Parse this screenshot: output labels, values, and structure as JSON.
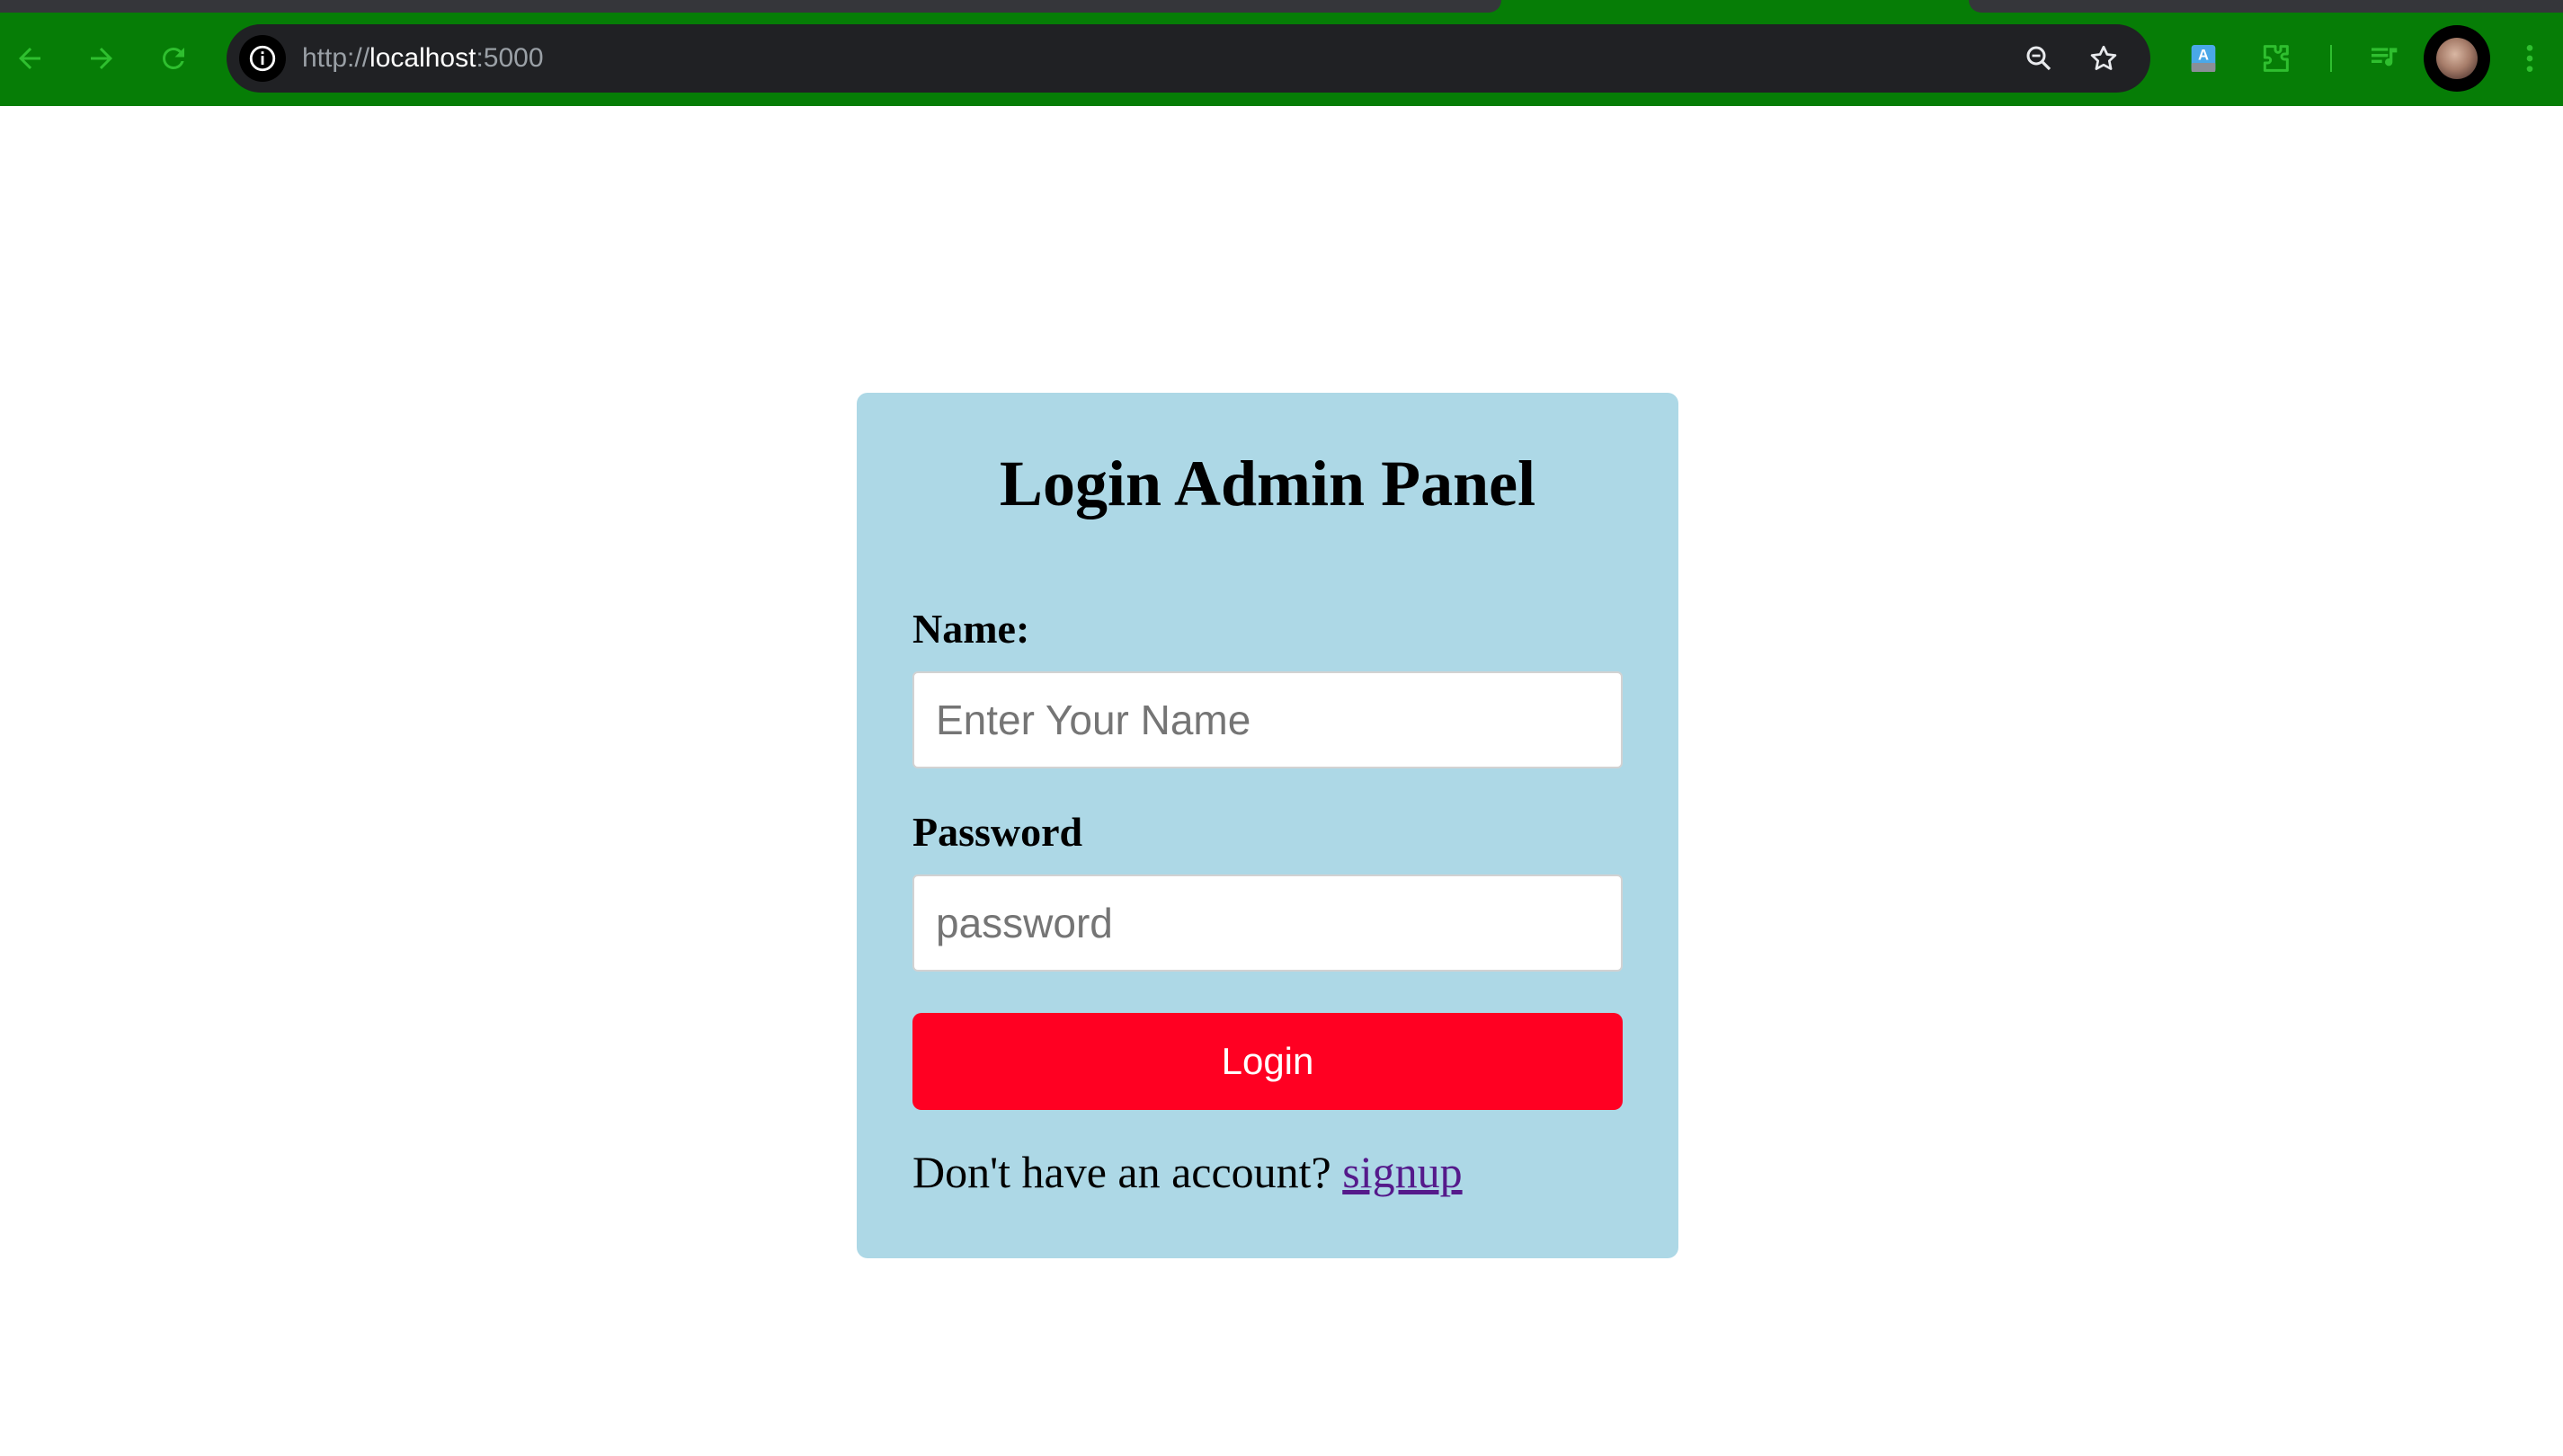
{
  "browser": {
    "url_scheme": "http://",
    "url_host": "localhost",
    "url_port": ":5000",
    "chrome_color": "#067d06"
  },
  "icons": {
    "back": "back-arrow-icon",
    "forward": "forward-arrow-icon",
    "reload": "reload-icon",
    "site_info": "info-icon",
    "zoom": "zoom-icon",
    "bookmark": "star-icon",
    "extension_a": "translate-extension-icon",
    "extensions": "puzzle-icon",
    "media": "media-playlist-icon",
    "menu": "kebab-menu-icon"
  },
  "login": {
    "title": "Login Admin Panel",
    "name_label": "Name:",
    "name_placeholder": "Enter Your Name",
    "name_value": "",
    "password_label": "Password",
    "password_placeholder": "password",
    "password_value": "",
    "button_label": "Login",
    "footer_text": "Don't have an account? ",
    "signup_link": "signup",
    "card_color": "#add8e6",
    "button_color": "#ff0022"
  }
}
